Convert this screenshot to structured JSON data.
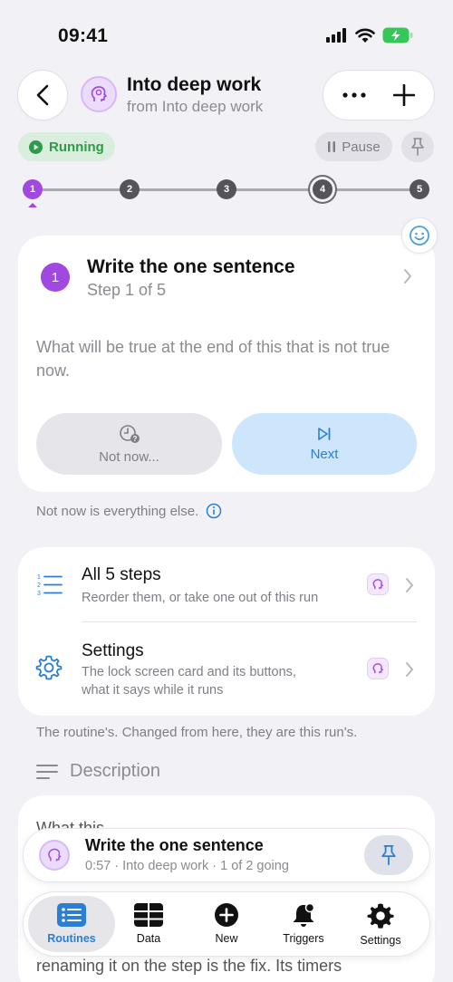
{
  "status_bar": {
    "time": "09:41"
  },
  "header": {
    "title": "Into deep work",
    "subtitle": "from Into deep work"
  },
  "run_state": {
    "running_label": "Running",
    "pause_label": "Pause"
  },
  "progress": {
    "steps": [
      "1",
      "2",
      "3",
      "4",
      "5"
    ],
    "current_step": 1
  },
  "current_step": {
    "number": "1",
    "title": "Write the one sentence",
    "count": "Step 1 of 5",
    "prompt": "What will be true at the end of this that is not true now.",
    "not_now_label": "Not now...",
    "next_label": "Next",
    "note": "Not now is everything else."
  },
  "rows": [
    {
      "title": "All 5 steps",
      "subtitle": "Reorder them, or take one out of this run",
      "icon": "numbered-list-icon"
    },
    {
      "title": "Settings",
      "subtitle_line1": "The lock screen card and its buttons,",
      "subtitle_line2": "what it says while it runs",
      "icon": "gear-icon"
    }
  ],
  "rows_note": "The routine's. Changed from here, they are this run's.",
  "description": {
    "header": "Description",
    "text_top": "What this",
    "text_bottom": "renaming it on the step is the fix. Its timers"
  },
  "now_playing": {
    "title": "Write the one sentence",
    "subtitle": "0:57 · Into deep work · 1 of 2 going"
  },
  "tabs": [
    {
      "label": "Routines",
      "icon": "list-icon",
      "active": true
    },
    {
      "label": "Data",
      "icon": "table-icon",
      "active": false
    },
    {
      "label": "New",
      "icon": "plus-circle-icon",
      "active": false
    },
    {
      "label": "Triggers",
      "icon": "bell-icon",
      "active": false
    },
    {
      "label": "Settings",
      "icon": "gear-icon",
      "active": false
    }
  ],
  "colors": {
    "accent_purple": "#a148e0",
    "accent_blue": "#2a7fd4",
    "running_green": "#2f9a49",
    "background": "#f2f1f6"
  }
}
